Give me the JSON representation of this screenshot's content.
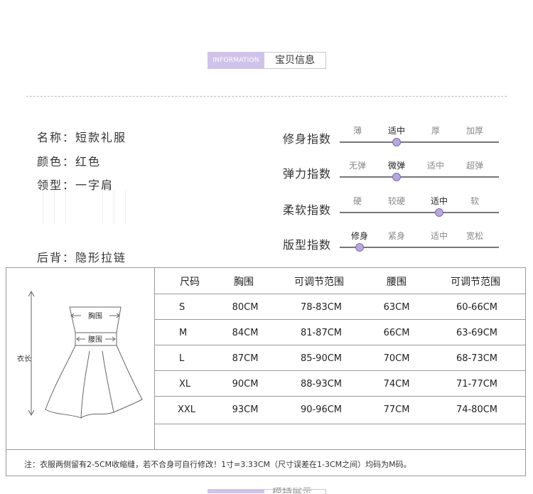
{
  "header": {
    "en": "INFORMATION",
    "cn": "宝贝信息"
  },
  "attributes": [
    {
      "label": "名称：",
      "value": "短款礼服"
    },
    {
      "label": "颜色：",
      "value": "红色"
    },
    {
      "label": "领型：",
      "value": "一字肩"
    },
    {
      "label": "后背：",
      "value": "隐形拉链"
    }
  ],
  "indexes": [
    {
      "label": "修身指数",
      "options": [
        "薄",
        "适中",
        "厚",
        "加厚"
      ],
      "selected": 1
    },
    {
      "label": "弹力指数",
      "options": [
        "无弹",
        "微弹",
        "适中",
        "超弹"
      ],
      "selected": 1
    },
    {
      "label": "柔软指数",
      "options": [
        "硬",
        "较硬",
        "适中",
        "软"
      ],
      "selected": 2
    },
    {
      "label": "版型指数",
      "options": [
        "修身",
        "紧身",
        "适中",
        "宽松"
      ],
      "selected": 0
    }
  ],
  "diagram": {
    "bust": "胸围",
    "waist": "腰围",
    "length": "衣长"
  },
  "colors": {
    "accent": "#cfc3ea",
    "knob": "#b6a7df"
  },
  "chart_data": {
    "type": "table",
    "columns": [
      "尺码",
      "胸围",
      "可调节范围",
      "腰围",
      "可调节范围"
    ],
    "rows": [
      [
        "S",
        "80CM",
        "78-83CM",
        "63CM",
        "60-66CM"
      ],
      [
        "M",
        "84CM",
        "81-87CM",
        "66CM",
        "63-69CM"
      ],
      [
        "L",
        "87CM",
        "85-90CM",
        "70CM",
        "68-73CM"
      ],
      [
        "XL",
        "90CM",
        "88-93CM",
        "74CM",
        "71-77CM"
      ],
      [
        "XXL",
        "93CM",
        "90-96CM",
        "77CM",
        "74-80CM"
      ]
    ]
  },
  "note": "注：衣服两侧留有2-5CM收缩缝，若不合身可自行修改！1寸=3.33CM（尺寸误差在1-3CM之间）均码为M码。",
  "next_header": {
    "cn": "模特展示"
  }
}
